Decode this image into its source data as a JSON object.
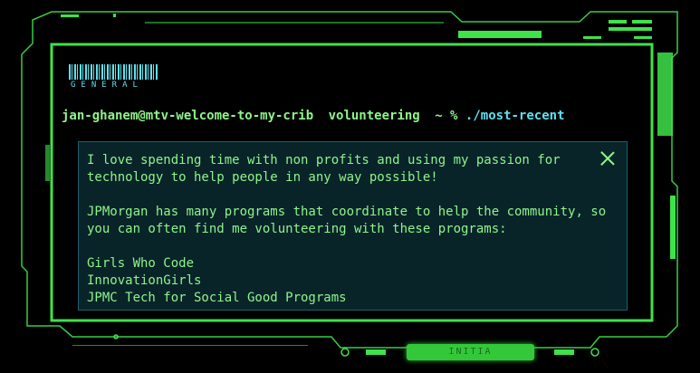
{
  "badge": {
    "label": "GENERAL"
  },
  "prompt": {
    "user_host": "jan-ghanem@mtv-welcome-to-my-crib",
    "directory": "volunteering",
    "symbol": "~ %",
    "command": "./most-recent"
  },
  "popup": {
    "lines": [
      "I love spending time with non profits and using my passion for",
      "technology to help people in any way possible!",
      "JPMorgan has many programs that coordinate to help the community, so",
      "you can often find me volunteering with these programs:",
      "Girls Who Code",
      "InnovationGirls",
      "JPMC Tech for Social Good Programs"
    ]
  },
  "footer": {
    "tab_label": "INITIA"
  },
  "colors": {
    "frame": "#3ee24a",
    "text": "#8ef58a",
    "accent": "#5ee0f0",
    "panel": "#082429"
  }
}
